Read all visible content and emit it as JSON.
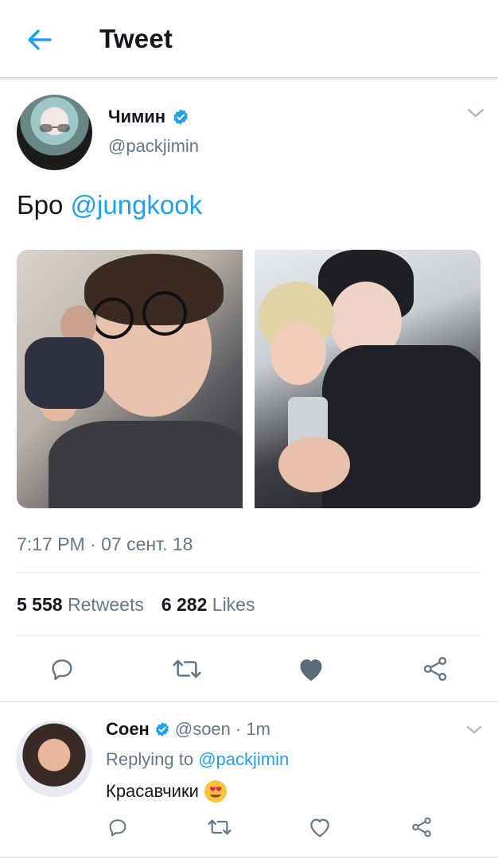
{
  "header": {
    "title": "Tweet",
    "back_icon": "arrow-left-icon",
    "accent": "#1da1f2"
  },
  "tweet": {
    "author": {
      "display_name": "Чимин",
      "handle": "@packjimin",
      "verified": true
    },
    "text_prefix": "Бро ",
    "text_mention": "@jungkook",
    "timestamp": "7:17 PM · 07 сент. 18",
    "stats": {
      "retweets_count": "5 558",
      "retweets_label": "Retweets",
      "likes_count": "6 282",
      "likes_label": "Likes"
    },
    "actions": [
      "reply-icon",
      "retweet-icon",
      "like-icon-filled",
      "share-icon"
    ],
    "liked": true
  },
  "reply": {
    "author": {
      "display_name": "Соен",
      "handle": "@soen",
      "time": "· 1m",
      "verified": true
    },
    "replying_prefix": "Replying to ",
    "replying_mention": "@packjimin",
    "text": "Красавчики",
    "emoji": "smiling-face-with-heart-eyes",
    "actions": [
      "reply-icon",
      "retweet-icon",
      "like-icon",
      "share-icon"
    ]
  },
  "colors": {
    "text": "#14171a",
    "muted": "#657786",
    "link": "#1da1f2",
    "divider": "#e1e8ed",
    "icon": "#657786"
  }
}
